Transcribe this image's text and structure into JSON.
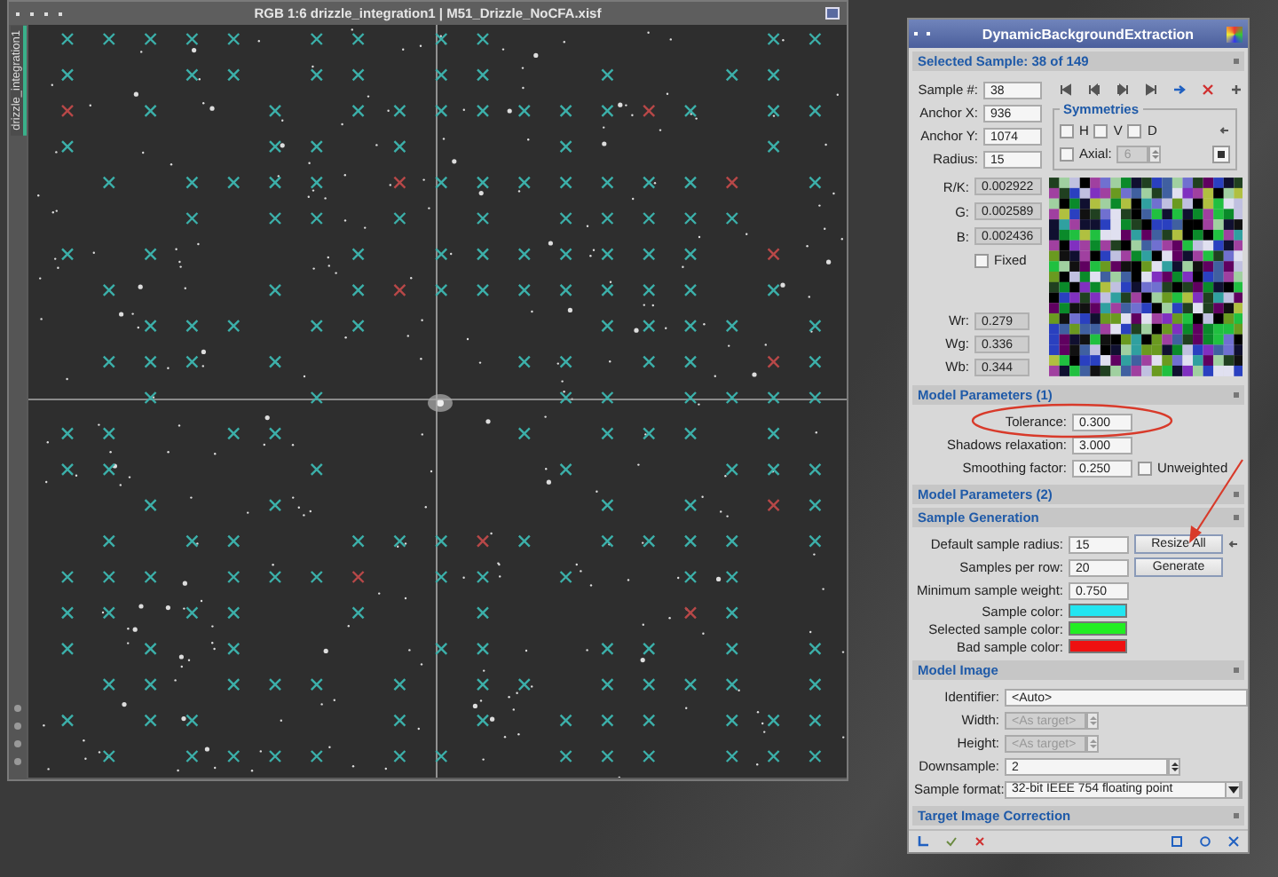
{
  "image_window": {
    "title": "RGB 1:6 drizzle_integration1 | M51_Drizzle_NoCFA.xisf",
    "side_tab": "drizzle_integration1"
  },
  "panel": {
    "title": "DynamicBackgroundExtraction",
    "selected_sample": {
      "header": "Selected Sample: 38 of 149",
      "fields": [
        {
          "label": "Sample #:",
          "value": "38"
        },
        {
          "label": "Anchor X:",
          "value": "936"
        },
        {
          "label": "Anchor Y:",
          "value": "1074"
        },
        {
          "label": "Radius:",
          "value": "15"
        }
      ],
      "symmetries": {
        "title": "Symmetries",
        "checks": [
          {
            "label": "H",
            "checked": false
          },
          {
            "label": "V",
            "checked": false
          },
          {
            "label": "D",
            "checked": false
          }
        ],
        "axial": {
          "label": "Axial:",
          "checked": false,
          "value": "6",
          "disabled": true
        }
      },
      "values": [
        {
          "label": "R/K:",
          "value": "0.002922"
        },
        {
          "label": "G:",
          "value": "0.002589"
        },
        {
          "label": "B:",
          "value": "0.002436"
        }
      ],
      "fixed": {
        "label": "Fixed",
        "checked": false
      },
      "weights": [
        {
          "label": "Wr:",
          "value": "0.279"
        },
        {
          "label": "Wg:",
          "value": "0.336"
        },
        {
          "label": "Wb:",
          "value": "0.344"
        }
      ]
    },
    "model_parameters_1": {
      "header": "Model Parameters (1)",
      "fields": [
        {
          "label": "Tolerance:",
          "value": "0.300"
        },
        {
          "label": "Shadows relaxation:",
          "value": "3.000"
        },
        {
          "label": "Smoothing factor:",
          "value": "0.250"
        }
      ],
      "unweighted": {
        "label": "Unweighted",
        "checked": false
      }
    },
    "model_parameters_2": {
      "header": "Model Parameters (2)"
    },
    "sample_generation": {
      "header": "Sample Generation",
      "fields": [
        {
          "label": "Default sample radius:",
          "value": "15",
          "button": "Resize All"
        },
        {
          "label": "Samples per row:",
          "value": "20",
          "button": "Generate"
        },
        {
          "label": "Minimum sample weight:",
          "value": "0.750"
        }
      ],
      "colors": [
        {
          "label": "Sample color:",
          "color": "#22e5f0"
        },
        {
          "label": "Selected sample color:",
          "color": "#22ee22"
        },
        {
          "label": "Bad sample color:",
          "color": "#ee1111"
        }
      ]
    },
    "model_image": {
      "header": "Model Image",
      "identifier": {
        "label": "Identifier:",
        "value": "<Auto>"
      },
      "spins": [
        {
          "label": "Width:",
          "value": "<As target>",
          "disabled": true
        },
        {
          "label": "Height:",
          "value": "<As target>",
          "disabled": true
        },
        {
          "label": "Downsample:",
          "value": "2",
          "disabled": false
        }
      ],
      "format": {
        "label": "Sample format:",
        "value": "32-bit IEEE 754 floating point"
      }
    },
    "target_image_correction": {
      "header": "Target Image Correction"
    }
  }
}
